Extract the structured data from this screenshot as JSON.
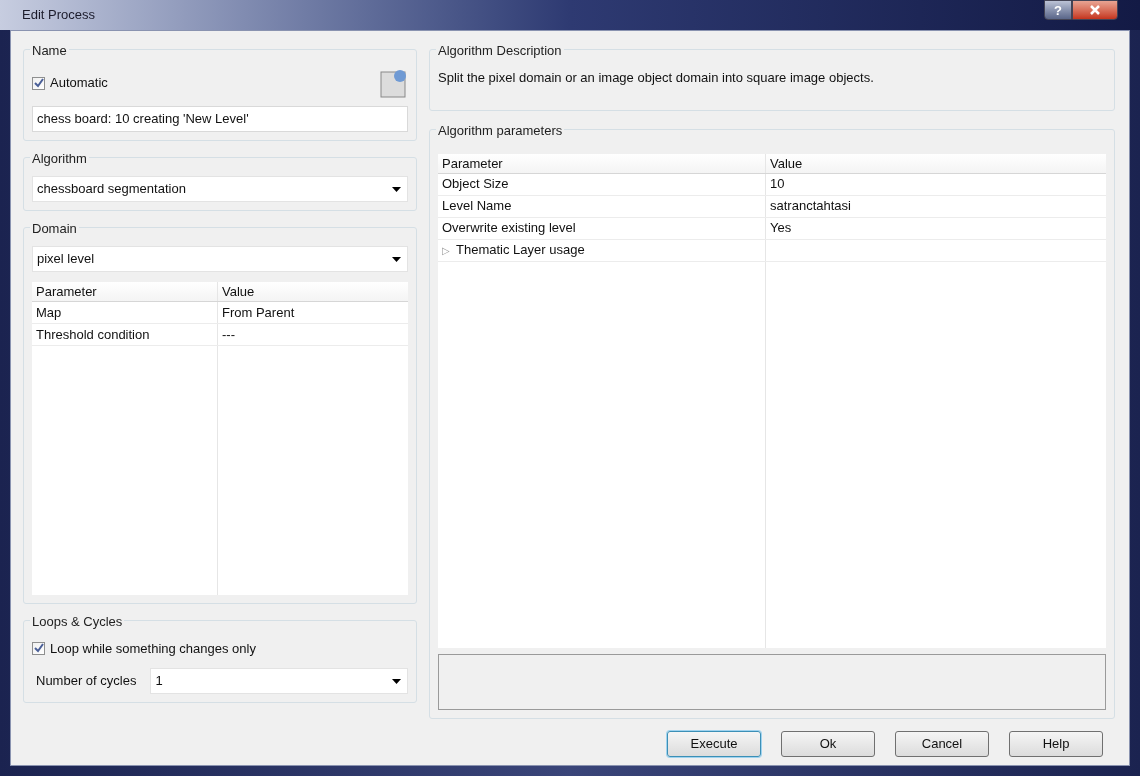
{
  "window": {
    "title": "Edit Process",
    "help": "?"
  },
  "name_group": {
    "label": "Name",
    "automatic": {
      "label": "Automatic",
      "checked": true
    },
    "value": "chess board: 10 creating 'New Level'"
  },
  "algorithm_group": {
    "label": "Algorithm",
    "value": "chessboard segmentation"
  },
  "domain_group": {
    "label": "Domain",
    "value": "pixel level",
    "table": {
      "columns": [
        "Parameter",
        "Value"
      ],
      "rows": [
        {
          "parameter": "Map",
          "value": "From Parent"
        },
        {
          "parameter": "Threshold condition",
          "value": "---"
        }
      ]
    }
  },
  "loops_group": {
    "label": "Loops & Cycles",
    "loop_option": {
      "label": "Loop while something changes only",
      "checked": true
    },
    "cycles_label": "Number of cycles",
    "cycles_value": "1"
  },
  "description_group": {
    "label": "Algorithm Description",
    "text": "Split the pixel domain or an image object domain into square image objects."
  },
  "parameters_group": {
    "label": "Algorithm parameters",
    "table": {
      "columns": [
        "Parameter",
        "Value"
      ],
      "rows": [
        {
          "parameter": "Object Size",
          "value": "10"
        },
        {
          "parameter": "Level Name",
          "value": "satranctahtasi"
        },
        {
          "parameter": "Overwrite existing level",
          "value": "Yes"
        },
        {
          "parameter": "Thematic Layer usage",
          "expander": "▷",
          "expanded": false
        }
      ]
    }
  },
  "buttons": [
    {
      "label": "Execute",
      "default": true
    },
    {
      "label": "Ok",
      "default": false
    },
    {
      "label": "Cancel",
      "default": false
    },
    {
      "label": "Help",
      "default": false
    }
  ]
}
